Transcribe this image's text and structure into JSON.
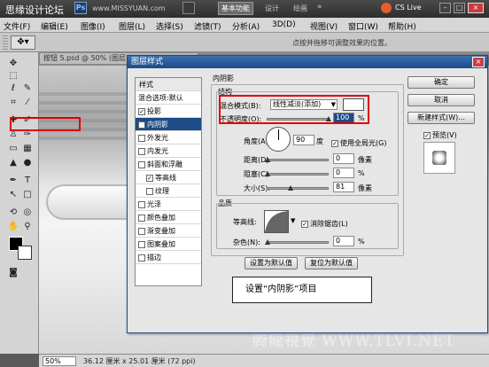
{
  "topbar": {
    "site": "思缘设计论坛",
    "site_url": "www.MISSYUAN.com",
    "app_badge": "Ps",
    "workspace": "基本功能",
    "tab_design": "设计",
    "tab_paint": "绘画",
    "more": "»",
    "cs_live": "CS Live"
  },
  "menu": [
    "文件(F)",
    "编辑(E)",
    "图像(I)",
    "图层(L)",
    "选择(S)",
    "滤镜(T)",
    "分析(A)",
    "3D(D)",
    "视图(V)",
    "窗口(W)",
    "帮助(H)"
  ],
  "optbar": {
    "hint": "点按并拖移可调整效果的位置。"
  },
  "document": {
    "tab": "按钮 5.psd @ 50% (图层 1",
    "zoom": "50%",
    "size": "36.12 厘米 x 25.01 厘米 (72 ppi)"
  },
  "watermark": "腾龍視覺 WWW.TLVI.NET",
  "dialog": {
    "title": "图层样式",
    "styles_header": "样式",
    "blend_default": "混合选项:默认",
    "styles": [
      {
        "label": "投影",
        "checked": true
      },
      {
        "label": "内阴影",
        "checked": true,
        "selected": true
      },
      {
        "label": "外发光",
        "checked": false
      },
      {
        "label": "内发光",
        "checked": false
      },
      {
        "label": "斜面和浮雕",
        "checked": false
      },
      {
        "label": "等高线",
        "checked": true,
        "indent": true
      },
      {
        "label": "纹理",
        "checked": false,
        "indent": true
      },
      {
        "label": "光泽",
        "checked": false
      },
      {
        "label": "颜色叠加",
        "checked": false
      },
      {
        "label": "渐变叠加",
        "checked": false
      },
      {
        "label": "图案叠加",
        "checked": false
      },
      {
        "label": "描边",
        "checked": false
      }
    ],
    "section_title": "内阴影",
    "structure": "结构",
    "blend_mode_label": "混合模式(B):",
    "blend_mode": "线性减淡(添加)",
    "opacity_label": "不透明度(O):",
    "opacity": "100",
    "percent": "%",
    "angle_label": "角度(A):",
    "angle": "90",
    "degree": "度",
    "global_light": "使用全局光(G)",
    "distance_label": "距离(D):",
    "distance": "0",
    "choke_label": "阻塞(C):",
    "choke": "0",
    "size_label": "大小(S):",
    "size": "81",
    "px": "像素",
    "quality": "品质",
    "contour_label": "等高线:",
    "anti_alias": "消除锯齿(L)",
    "noise_label": "杂色(N):",
    "noise": "0",
    "set_default": "设置为默认值",
    "reset_default": "复位为默认值",
    "ok": "确定",
    "cancel": "取消",
    "new_style": "新建样式(W)...",
    "preview": "预览(V)"
  },
  "note": "设置“内阴影”项目",
  "colors": {
    "dialog_title": "#1d4b86",
    "highlight": "#e00000",
    "selected_row": "#1d4b86"
  }
}
